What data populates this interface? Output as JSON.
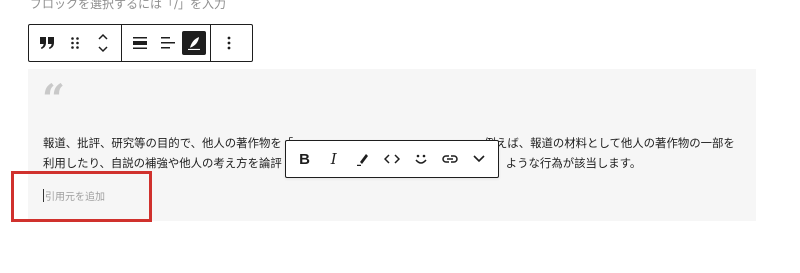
{
  "hint": {
    "text": "ブロックを選択するには「/」を入力"
  },
  "block_toolbar": {
    "buttons": [
      {
        "name": "quote",
        "icon": "quote-icon"
      },
      {
        "name": "drag",
        "icon": "drag-handle-icon"
      },
      {
        "name": "move",
        "icon": "move-up-down-icon"
      },
      {
        "name": "align",
        "icon": "align-wide-icon"
      },
      {
        "name": "text-align",
        "icon": "text-align-left-icon"
      },
      {
        "name": "style",
        "icon": "feather-pen-icon",
        "active": true
      },
      {
        "name": "options",
        "icon": "more-vertical-icon"
      }
    ]
  },
  "quote": {
    "mark": "“",
    "line1": "報道、批評、研究等の目的で、他人の著作物を「",
    "line1_end": "。例えば、報道の材料として他人の著作物の一部を",
    "line2": "利用したり、自説の補強や他人の考え方を論評",
    "line2_end": "ような行為が該当します。",
    "citation_placeholder": "引用元を追加"
  },
  "format_toolbar": {
    "bold": "B",
    "italic": "I",
    "icons": [
      "highlight-icon",
      "code-icon",
      "emoji-icon",
      "link-icon",
      "chevron-down-icon"
    ]
  },
  "colors": {
    "highlight_border": "#d0312d",
    "quote_background": "#f6f6f6",
    "toolbar_border": "#1e1e1e"
  }
}
